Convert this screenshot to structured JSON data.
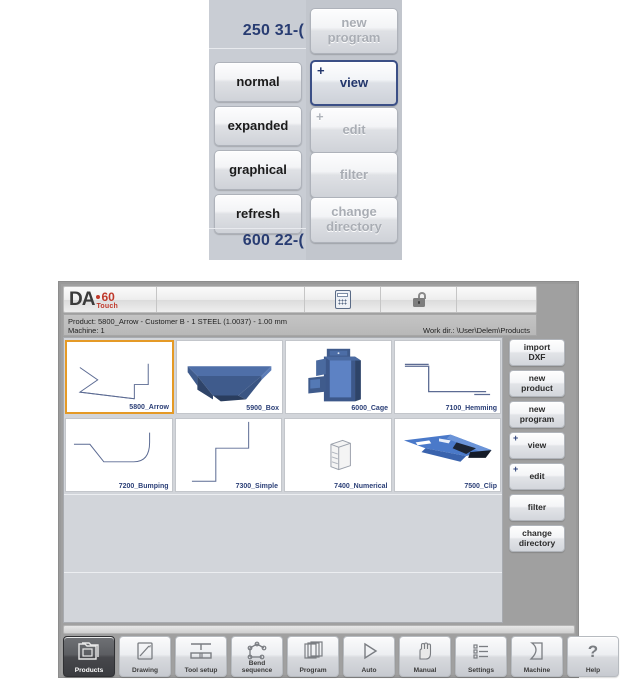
{
  "top_panel": {
    "value_top": "250 31-(",
    "value_bottom": "600 22-(",
    "left_buttons": [
      {
        "label": "normal",
        "state": "enabled"
      },
      {
        "label": "expanded",
        "state": "enabled"
      },
      {
        "label": "graphical",
        "state": "enabled"
      },
      {
        "label": "refresh",
        "state": "enabled"
      }
    ],
    "right_buttons": [
      {
        "label": "new\nprogram",
        "line1": "new",
        "line2": "program",
        "state": "disabled",
        "plus": false,
        "selected": false
      },
      {
        "label": "view",
        "line1": "view",
        "line2": "",
        "state": "enabled",
        "plus": true,
        "selected": true
      },
      {
        "label": "edit",
        "line1": "edit",
        "line2": "",
        "state": "disabled",
        "plus": true,
        "selected": false
      },
      {
        "label": "filter",
        "line1": "filter",
        "line2": "",
        "state": "disabled",
        "plus": false,
        "selected": false
      },
      {
        "label": "change\ndirectory",
        "line1": "change",
        "line2": "directory",
        "state": "disabled",
        "plus": false,
        "selected": false
      }
    ]
  },
  "app": {
    "header": {
      "logo_main": "DA",
      "logo_number": "60",
      "logo_sub": "Touch",
      "icons": [
        "calculator-icon",
        "unlocked-padlock-icon"
      ]
    },
    "info_bar": {
      "product_line": "Product: 5800_Arrow - Customer B - 1 STEEL (1.0037) - 1.00 mm",
      "machine_line": "Machine: 1",
      "work_dir_line": "Work dir.: \\User\\Delem\\Products"
    },
    "products": [
      {
        "name": "5800_Arrow",
        "selected": true,
        "thumb": "profile-arrow"
      },
      {
        "name": "5900_Box",
        "selected": false,
        "thumb": "solid-box"
      },
      {
        "name": "6000_Cage",
        "selected": false,
        "thumb": "solid-cage"
      },
      {
        "name": "7100_Hemming",
        "selected": false,
        "thumb": "profile-hemming"
      },
      {
        "name": "7200_Bumping",
        "selected": false,
        "thumb": "profile-bumping"
      },
      {
        "name": "7300_Simple",
        "selected": false,
        "thumb": "profile-simple"
      },
      {
        "name": "7400_Numerical",
        "selected": false,
        "thumb": "stack-icon"
      },
      {
        "name": "7500_Clip",
        "selected": false,
        "thumb": "solid-clip"
      }
    ],
    "side_buttons": [
      {
        "line1": "import",
        "line2": "DXF",
        "plus": false
      },
      {
        "line1": "new",
        "line2": "product",
        "plus": false
      },
      {
        "line1": "new",
        "line2": "program",
        "plus": false
      },
      {
        "line1": "view",
        "line2": "",
        "plus": true
      },
      {
        "line1": "edit",
        "line2": "",
        "plus": true
      },
      {
        "line1": "filter",
        "line2": "",
        "plus": false
      },
      {
        "line1": "change",
        "line2": "directory",
        "plus": false
      }
    ],
    "nav_buttons": [
      {
        "label": "Products",
        "line1": "Products",
        "line2": "",
        "icon": "folder-icon",
        "active": true
      },
      {
        "label": "Drawing",
        "line1": "Drawing",
        "line2": "",
        "icon": "pencil-page-icon",
        "active": false
      },
      {
        "label": "Tool setup",
        "line1": "Tool setup",
        "line2": "",
        "icon": "press-tool-icon",
        "active": false
      },
      {
        "label": "Bend sequence",
        "line1": "Bend",
        "line2": "sequence",
        "icon": "bend-sequence-icon",
        "active": false
      },
      {
        "label": "Program",
        "line1": "Program",
        "line2": "",
        "icon": "documents-icon",
        "active": false
      },
      {
        "label": "Auto",
        "line1": "Auto",
        "line2": "",
        "icon": "play-triangle-icon",
        "active": false
      },
      {
        "label": "Manual",
        "line1": "Manual",
        "line2": "",
        "icon": "hand-icon",
        "active": false
      },
      {
        "label": "Settings",
        "line1": "Settings",
        "line2": "",
        "icon": "list-settings-icon",
        "active": false
      },
      {
        "label": "Machine",
        "line1": "Machine",
        "line2": "",
        "icon": "bent-page-icon",
        "active": false
      },
      {
        "label": "Help",
        "line1": "Help",
        "line2": "",
        "icon": "question-mark-icon",
        "active": false
      }
    ]
  },
  "colors": {
    "accent_selected": "#e59a26",
    "label_blue": "#2b3f77",
    "logo_red": "#c0392b",
    "panel_gray": "#c9cdd4"
  }
}
